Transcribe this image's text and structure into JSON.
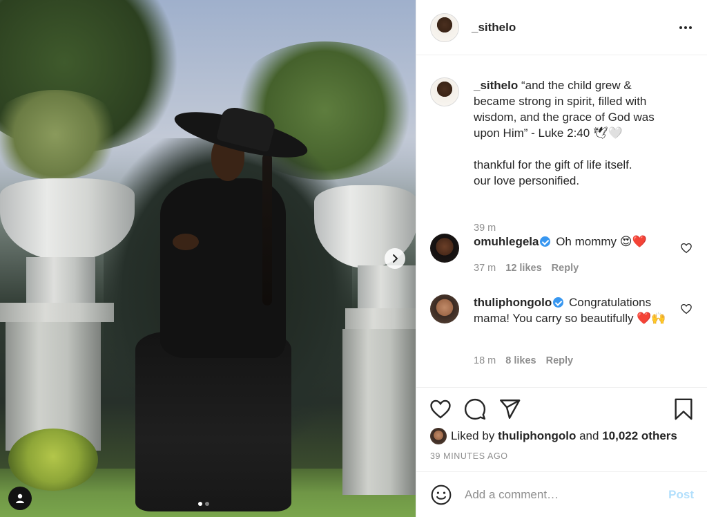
{
  "post": {
    "username": "_sithelo",
    "more_icon": "more-horizontal-icon",
    "caption": {
      "username": "_sithelo",
      "text_parts": [
        "“and the child grew & became strong in spirit, filled with wisdom, and the grace of God was upon Him” - Luke 2:40 🕊🤍",
        "thankful for the gift of life itself.",
        "our love personified."
      ],
      "time": "39 m"
    },
    "comments": [
      {
        "username": "omuhlegela",
        "verified": true,
        "text": "Oh mommy 😍❤️",
        "time": "37 m",
        "likes": "12 likes",
        "reply": "Reply"
      },
      {
        "username": "thuliphongolo",
        "verified": true,
        "text": "Congratulations mama! You carry so beautifully ❤️🙌",
        "time": "18 m",
        "likes": "8 likes",
        "reply": "Reply"
      }
    ],
    "liked_by": {
      "prefix": "Liked by",
      "user": "thuliphongolo",
      "and": "and",
      "others": "10,022 others"
    },
    "time_ago": "39 MINUTES AGO",
    "add_comment": {
      "placeholder": "Add a comment…",
      "post_label": "Post"
    },
    "carousel": {
      "slide_count": 2,
      "active_index": 0
    },
    "colors": {
      "verified": "#3897f0",
      "post_disabled": "#b2dffc",
      "muted": "#8e8e8e",
      "text": "#262626"
    }
  }
}
